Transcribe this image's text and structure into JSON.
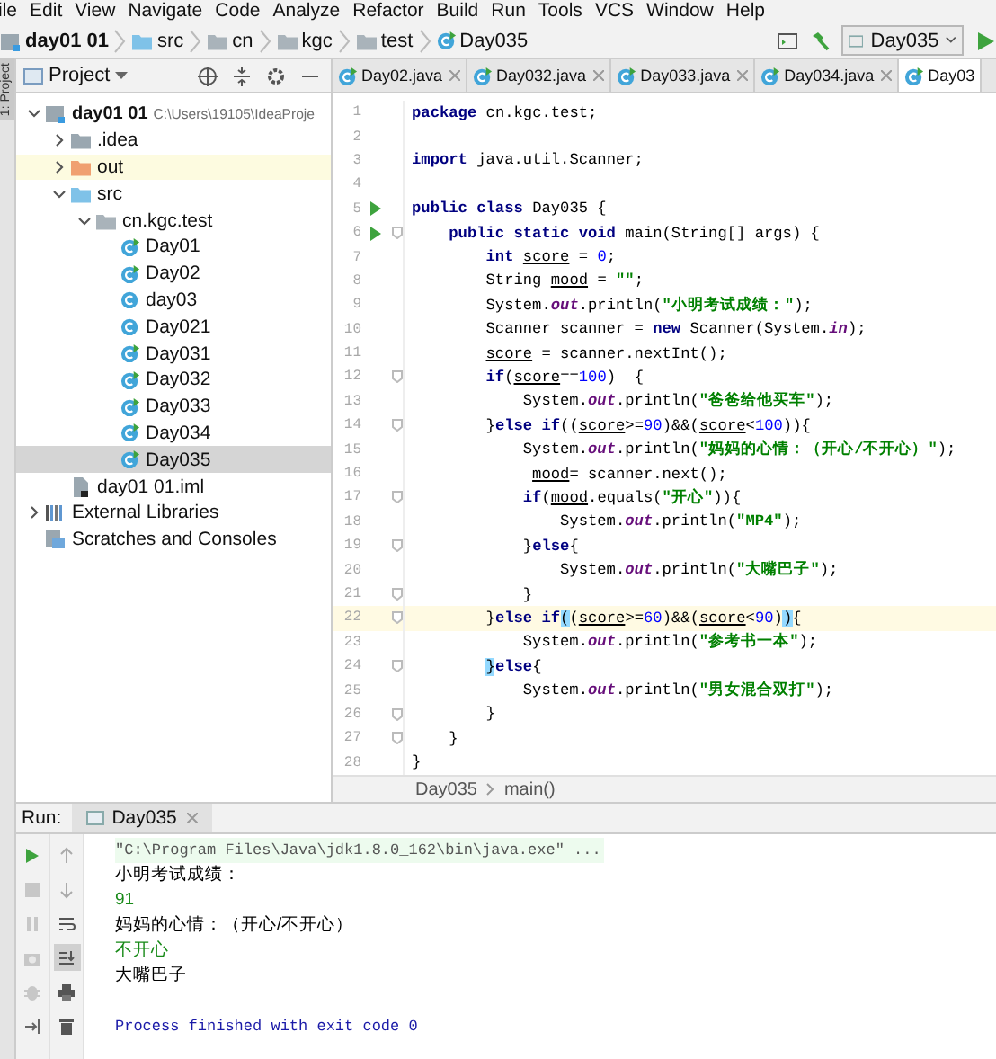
{
  "menu": [
    "ile",
    "Edit",
    "View",
    "Navigate",
    "Code",
    "Analyze",
    "Refactor",
    "Build",
    "Run",
    "Tools",
    "VCS",
    "Window",
    "Help"
  ],
  "breadcrumbs": [
    {
      "label": "day01 01",
      "kind": "module"
    },
    {
      "label": "src",
      "kind": "source"
    },
    {
      "label": "cn",
      "kind": "package"
    },
    {
      "label": "kgc",
      "kind": "package"
    },
    {
      "label": "test",
      "kind": "package"
    },
    {
      "label": "Day035",
      "kind": "class"
    }
  ],
  "run_config": "Day035",
  "side_strip": "1: Project",
  "project": {
    "title": "Project",
    "tree": [
      {
        "label": "day01 01",
        "path": "C:\\Users\\19105\\IdeaProje",
        "kind": "module",
        "expanded": true,
        "selected": false,
        "highlighted": false,
        "children": [
          {
            "label": ".idea",
            "kind": "folder",
            "expanded": false,
            "selected": false,
            "highlighted": false
          },
          {
            "label": "out",
            "kind": "excluded",
            "expanded": false,
            "selected": false,
            "highlighted": true
          },
          {
            "label": "src",
            "kind": "source",
            "expanded": true,
            "selected": false,
            "highlighted": false,
            "children": [
              {
                "label": "cn.kgc.test",
                "kind": "package",
                "expanded": true,
                "selected": false,
                "highlighted": false,
                "children": [
                  {
                    "label": "Day01",
                    "kind": "class_run",
                    "selected": false,
                    "highlighted": false
                  },
                  {
                    "label": "Day02",
                    "kind": "class_run",
                    "selected": false,
                    "highlighted": false
                  },
                  {
                    "label": "day03",
                    "kind": "class",
                    "selected": false,
                    "highlighted": false
                  },
                  {
                    "label": "Day021",
                    "kind": "class",
                    "selected": false,
                    "highlighted": false
                  },
                  {
                    "label": "Day031",
                    "kind": "class_run",
                    "selected": false,
                    "highlighted": false
                  },
                  {
                    "label": "Day032",
                    "kind": "class_run",
                    "selected": false,
                    "highlighted": false
                  },
                  {
                    "label": "Day033",
                    "kind": "class_run",
                    "selected": false,
                    "highlighted": false
                  },
                  {
                    "label": "Day034",
                    "kind": "class_run",
                    "selected": false,
                    "highlighted": false
                  },
                  {
                    "label": "Day035",
                    "kind": "class_run",
                    "selected": true,
                    "highlighted": false
                  }
                ]
              }
            ]
          },
          {
            "label": "day01 01.iml",
            "kind": "iml",
            "selected": false,
            "highlighted": false
          }
        ]
      },
      {
        "label": "External Libraries",
        "kind": "libraries",
        "expanded": false,
        "selected": false,
        "highlighted": false
      },
      {
        "label": "Scratches and Consoles",
        "kind": "scratches",
        "selected": false,
        "highlighted": false
      }
    ]
  },
  "tabs": [
    {
      "label": "Day02.java",
      "selected": false
    },
    {
      "label": "Day032.java",
      "selected": false
    },
    {
      "label": "Day033.java",
      "selected": false
    },
    {
      "label": "Day034.java",
      "selected": false
    },
    {
      "label": "Day03",
      "selected": true
    }
  ],
  "editor": {
    "lines": [
      {
        "number": "1",
        "runnable": false,
        "fold": false,
        "current": false,
        "tokens": [
          {
            "kind": "keyword",
            "text": "package"
          },
          {
            "kind": "plain",
            "text": " cn.kgc.test;"
          }
        ]
      },
      {
        "number": "2",
        "runnable": false,
        "fold": false,
        "current": false
      },
      {
        "number": "3",
        "runnable": false,
        "fold": false,
        "current": false,
        "tokens": [
          {
            "kind": "keyword",
            "text": "import"
          },
          {
            "kind": "plain",
            "text": " java.util.Scanner;"
          }
        ]
      },
      {
        "number": "4",
        "runnable": false,
        "fold": false,
        "current": false
      },
      {
        "number": "5",
        "runnable": true,
        "fold": false,
        "current": false,
        "tokens": [
          {
            "kind": "keyword",
            "text": "public class"
          },
          {
            "kind": "plain",
            "text": " Day035 {"
          }
        ]
      },
      {
        "number": "6",
        "runnable": true,
        "fold": true,
        "current": false,
        "tokens": [
          {
            "kind": "keyword",
            "text": "    public static void"
          },
          {
            "kind": "plain",
            "text": " main(String[] args) {"
          }
        ]
      },
      {
        "number": "7",
        "runnable": false,
        "fold": false,
        "current": false,
        "tokens": [
          {
            "kind": "keyword",
            "text": "        int"
          },
          {
            "kind": "var",
            "text": " score"
          },
          {
            "kind": "plain",
            "text": " = "
          },
          {
            "kind": "number",
            "text": "0"
          },
          {
            "kind": "plain",
            "text": ";"
          }
        ]
      },
      {
        "number": "8",
        "runnable": false,
        "fold": false,
        "current": false,
        "tokens": [
          {
            "kind": "plain",
            "text": "        String "
          },
          {
            "kind": "var",
            "text": "mood"
          },
          {
            "kind": "plain",
            "text": " = "
          },
          {
            "kind": "string",
            "text": "\"\""
          },
          {
            "kind": "plain",
            "text": ";"
          }
        ]
      },
      {
        "number": "9",
        "runnable": false,
        "fold": false,
        "current": false,
        "tokens": [
          {
            "kind": "plain",
            "text": "        System."
          },
          {
            "kind": "field",
            "text": "out"
          },
          {
            "kind": "plain",
            "text": ".println("
          },
          {
            "kind": "string",
            "text": "\"小明考试成绩：\""
          },
          {
            "kind": "plain",
            "text": ");"
          }
        ]
      },
      {
        "number": "10",
        "runnable": false,
        "fold": false,
        "current": false,
        "tokens": [
          {
            "kind": "plain",
            "text": "        Scanner scanner = "
          },
          {
            "kind": "keyword",
            "text": "new"
          },
          {
            "kind": "plain",
            "text": " Scanner(System."
          },
          {
            "kind": "field",
            "text": "in"
          },
          {
            "kind": "plain",
            "text": ");"
          }
        ]
      },
      {
        "number": "11",
        "runnable": false,
        "fold": false,
        "current": false,
        "tokens": [
          {
            "kind": "var",
            "text": "        score"
          },
          {
            "kind": "plain",
            "text": " = scanner.nextInt();"
          }
        ]
      },
      {
        "number": "12",
        "runnable": false,
        "fold": true,
        "current": false,
        "tokens": [
          {
            "kind": "keyword",
            "text": "        if"
          },
          {
            "kind": "plain",
            "text": "("
          },
          {
            "kind": "var",
            "text": "score"
          },
          {
            "kind": "plain",
            "text": "=="
          },
          {
            "kind": "number",
            "text": "100"
          },
          {
            "kind": "plain",
            "text": ")  {"
          }
        ]
      },
      {
        "number": "13",
        "runnable": false,
        "fold": false,
        "current": false,
        "tokens": [
          {
            "kind": "plain",
            "text": "            System."
          },
          {
            "kind": "field",
            "text": "out"
          },
          {
            "kind": "plain",
            "text": ".println("
          },
          {
            "kind": "string",
            "text": "\"爸爸给他买车\""
          },
          {
            "kind": "plain",
            "text": ");"
          }
        ]
      },
      {
        "number": "14",
        "runnable": false,
        "fold": true,
        "current": false,
        "tokens": [
          {
            "kind": "plain",
            "text": "        }"
          },
          {
            "kind": "keyword",
            "text": "else if"
          },
          {
            "kind": "plain",
            "text": "(("
          },
          {
            "kind": "var",
            "text": "score"
          },
          {
            "kind": "plain",
            "text": ">="
          },
          {
            "kind": "number",
            "text": "90"
          },
          {
            "kind": "plain",
            "text": ")&&("
          },
          {
            "kind": "var",
            "text": "score"
          },
          {
            "kind": "plain",
            "text": "<"
          },
          {
            "kind": "number",
            "text": "100"
          },
          {
            "kind": "plain",
            "text": ")){"
          }
        ]
      },
      {
        "number": "15",
        "runnable": false,
        "fold": false,
        "current": false,
        "tokens": [
          {
            "kind": "plain",
            "text": "            System."
          },
          {
            "kind": "field",
            "text": "out"
          },
          {
            "kind": "plain",
            "text": ".println("
          },
          {
            "kind": "string",
            "text": "\"妈妈的心情：（开心/不开心）\""
          },
          {
            "kind": "plain",
            "text": ");"
          }
        ]
      },
      {
        "number": "16",
        "runnable": false,
        "fold": false,
        "current": false,
        "tokens": [
          {
            "kind": "var",
            "text": "             mood"
          },
          {
            "kind": "plain",
            "text": "= scanner.next();"
          }
        ]
      },
      {
        "number": "17",
        "runnable": false,
        "fold": true,
        "current": false,
        "tokens": [
          {
            "kind": "keyword",
            "text": "            if"
          },
          {
            "kind": "plain",
            "text": "("
          },
          {
            "kind": "var",
            "text": "mood"
          },
          {
            "kind": "plain",
            "text": ".equals("
          },
          {
            "kind": "string",
            "text": "\"开心\""
          },
          {
            "kind": "plain",
            "text": ")){"
          }
        ]
      },
      {
        "number": "18",
        "runnable": false,
        "fold": false,
        "current": false,
        "tokens": [
          {
            "kind": "plain",
            "text": "                System."
          },
          {
            "kind": "field",
            "text": "out"
          },
          {
            "kind": "plain",
            "text": ".println("
          },
          {
            "kind": "string",
            "text": "\"MP4\""
          },
          {
            "kind": "plain",
            "text": ");"
          }
        ]
      },
      {
        "number": "19",
        "runnable": false,
        "fold": true,
        "current": false,
        "tokens": [
          {
            "kind": "plain",
            "text": "            }"
          },
          {
            "kind": "keyword",
            "text": "else"
          },
          {
            "kind": "plain",
            "text": "{"
          }
        ]
      },
      {
        "number": "20",
        "runnable": false,
        "fold": false,
        "current": false,
        "tokens": [
          {
            "kind": "plain",
            "text": "                System."
          },
          {
            "kind": "field",
            "text": "out"
          },
          {
            "kind": "plain",
            "text": ".println("
          },
          {
            "kind": "string",
            "text": "\"大嘴巴子\""
          },
          {
            "kind": "plain",
            "text": ");"
          }
        ]
      },
      {
        "number": "21",
        "runnable": false,
        "fold": true,
        "current": false,
        "tokens": [
          {
            "kind": "plain",
            "text": "            }"
          }
        ]
      },
      {
        "number": "22",
        "runnable": false,
        "fold": true,
        "current": true,
        "tokens": [
          {
            "kind": "plain",
            "text": "        }"
          },
          {
            "kind": "keyword",
            "text": "else if"
          },
          {
            "kind": "brace_match",
            "text": "("
          },
          {
            "kind": "plain",
            "text": "("
          },
          {
            "kind": "var",
            "text": "score"
          },
          {
            "kind": "plain",
            "text": ">="
          },
          {
            "kind": "number",
            "text": "60"
          },
          {
            "kind": "plain",
            "text": ")&&("
          },
          {
            "kind": "var",
            "text": "score"
          },
          {
            "kind": "plain",
            "text": "<"
          },
          {
            "kind": "number",
            "text": "90"
          },
          {
            "kind": "plain",
            "text": ")"
          },
          {
            "kind": "brace_match",
            "text": ")"
          },
          {
            "kind": "plain",
            "text": "{"
          }
        ]
      },
      {
        "number": "23",
        "runnable": false,
        "fold": false,
        "current": false,
        "tokens": [
          {
            "kind": "plain",
            "text": "            System."
          },
          {
            "kind": "field",
            "text": "out"
          },
          {
            "kind": "plain",
            "text": ".println("
          },
          {
            "kind": "string",
            "text": "\"参考书一本\""
          },
          {
            "kind": "plain",
            "text": ");"
          }
        ]
      },
      {
        "number": "24",
        "runnable": false,
        "fold": true,
        "current": false,
        "tokens": [
          {
            "kind": "brace_match",
            "text": "        }"
          },
          {
            "kind": "keyword",
            "text": "else"
          },
          {
            "kind": "plain",
            "text": "{"
          }
        ]
      },
      {
        "number": "25",
        "runnable": false,
        "fold": false,
        "current": false,
        "tokens": [
          {
            "kind": "plain",
            "text": "            System."
          },
          {
            "kind": "field",
            "text": "out"
          },
          {
            "kind": "plain",
            "text": ".println("
          },
          {
            "kind": "string",
            "text": "\"男女混合双打\""
          },
          {
            "kind": "plain",
            "text": ");"
          }
        ]
      },
      {
        "number": "26",
        "runnable": false,
        "fold": true,
        "current": false,
        "tokens": [
          {
            "kind": "plain",
            "text": "        }"
          }
        ]
      },
      {
        "number": "27",
        "runnable": false,
        "fold": true,
        "current": false,
        "tokens": [
          {
            "kind": "plain",
            "text": "    }"
          }
        ]
      },
      {
        "number": "28",
        "runnable": false,
        "fold": false,
        "current": false,
        "tokens": [
          {
            "kind": "plain",
            "text": "}"
          }
        ]
      }
    ],
    "breadcrumbs": [
      "Day035",
      "main()"
    ]
  },
  "run": {
    "label": "Run:",
    "tab": "Day035",
    "left_tools": [
      {
        "kind": "run",
        "disabled": false
      },
      {
        "kind": "stop",
        "disabled": true
      },
      {
        "kind": "pause",
        "disabled": true
      },
      {
        "kind": "camera",
        "disabled": true
      },
      {
        "kind": "debug",
        "disabled": true
      },
      {
        "kind": "exit",
        "disabled": false
      }
    ],
    "right_tools": [
      {
        "kind": "up",
        "selected": false
      },
      {
        "kind": "down",
        "selected": false
      },
      {
        "kind": "wrap",
        "selected": false
      },
      {
        "kind": "scroll_end",
        "selected": true
      },
      {
        "kind": "print",
        "selected": false
      },
      {
        "kind": "trash",
        "selected": false
      }
    ],
    "output": [
      {
        "kind": "command",
        "text": "\"C:\\Program Files\\Java\\jdk1.8.0_162\\bin\\java.exe\" ..."
      },
      {
        "kind": "stdout",
        "text": "小明考试成绩："
      },
      {
        "kind": "input",
        "text": "91"
      },
      {
        "kind": "stdout",
        "text": "妈妈的心情：（开心/不开心）"
      },
      {
        "kind": "input",
        "text": "不开心"
      },
      {
        "kind": "stdout",
        "text": "大嘴巴子"
      },
      {
        "kind": "exit",
        "text": "Process finished with exit code 0"
      }
    ]
  }
}
